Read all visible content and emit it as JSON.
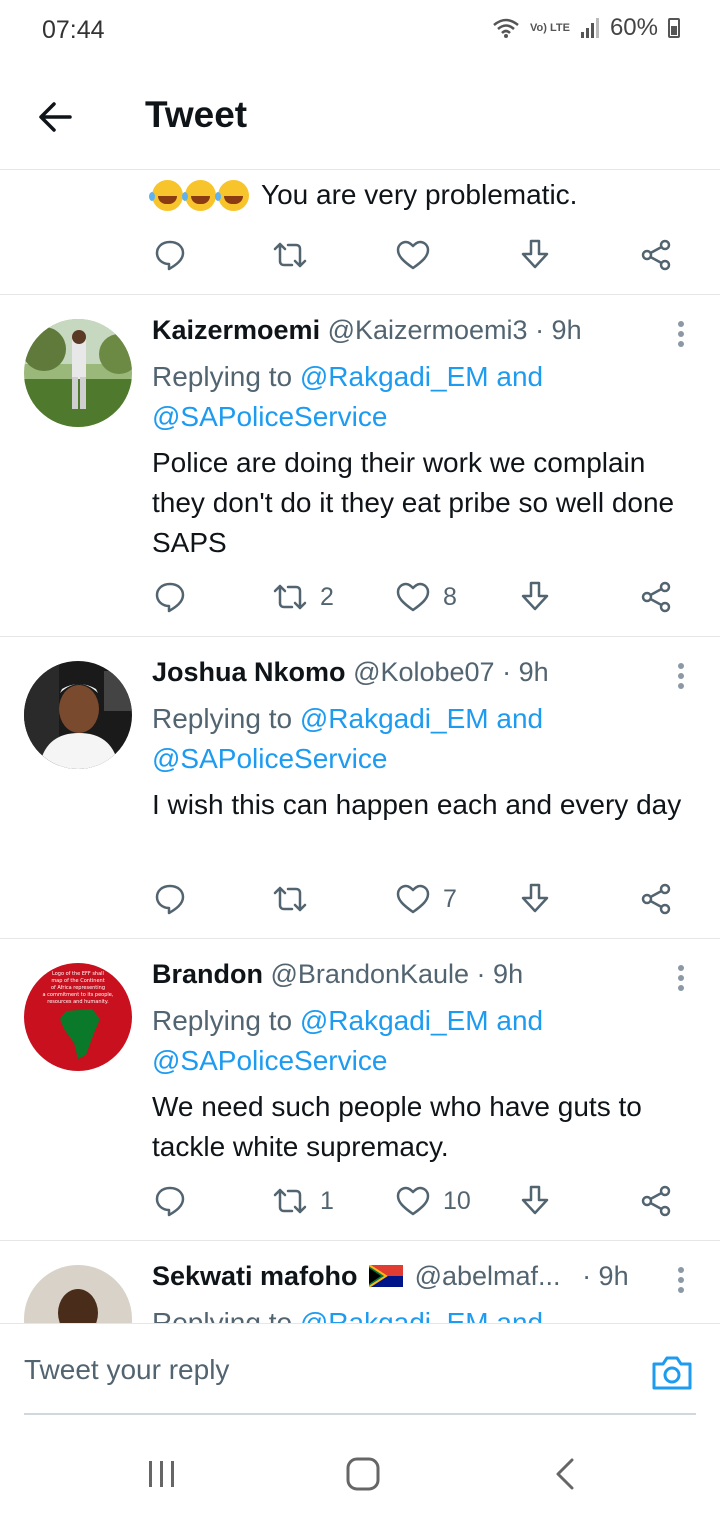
{
  "status_bar": {
    "time": "07:44",
    "network": "Vo) LTE",
    "battery": "60%"
  },
  "header": {
    "title": "Tweet"
  },
  "first_tweet": {
    "text": "You are very problematic.",
    "emoji": "joy-emoji"
  },
  "tweets": [
    {
      "name": "Kaizermoemi",
      "handle": "@Kaizermoemi3 · 9h",
      "replying_prefix": "Replying to ",
      "replying_mention": "@Rakgadi_EM and",
      "replying_mention2": "@SAPoliceService",
      "body": "Police are doing their work we complain they don't do it they eat pribe so well done SAPS",
      "retweets": "2",
      "likes": "8"
    },
    {
      "name": "Joshua Nkomo",
      "handle": "@Kolobe07 · 9h",
      "replying_prefix": "Replying to ",
      "replying_mention": "@Rakgadi_EM and",
      "replying_mention2": "@SAPoliceService",
      "body": "I wish this can happen each and every day",
      "retweets": "",
      "likes": "7"
    },
    {
      "name": "Brandon",
      "handle": "@BrandonKaule · 9h",
      "replying_prefix": "Replying to ",
      "replying_mention": "@Rakgadi_EM and",
      "replying_mention2": "@SAPoliceService",
      "body": "We need such people who have guts to tackle white supremacy.",
      "retweets": "1",
      "likes": "10",
      "avatar_text": "Logo of the EFF shall map of the Continent of Africa representing a commitment to its people, resources and humanity."
    },
    {
      "name": "Sekwati mafoho",
      "handle": "@abelmaf...",
      "time": "· 9h",
      "replying_prefix": "Replying to ",
      "replying_mention": "@Rakgadi_EM and"
    }
  ],
  "composer": {
    "placeholder": "Tweet your reply"
  },
  "colors": {
    "accent": "#1d9bf0",
    "text": "#0f1419",
    "muted": "#536471",
    "divider": "#e6e6e6"
  }
}
